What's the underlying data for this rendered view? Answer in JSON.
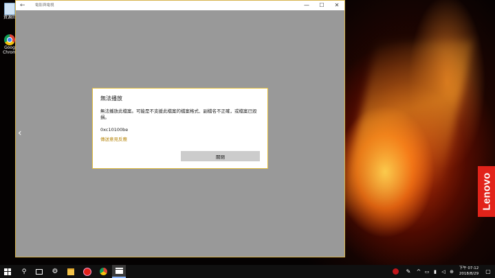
{
  "desktop": {
    "icons": [
      {
        "label": "資源回"
      },
      {
        "label": "Goog Chrom"
      }
    ],
    "brand": "Lenovo"
  },
  "window": {
    "title": "電影與電視",
    "back_glyph": "←",
    "min_glyph": "—",
    "max_glyph": "☐",
    "close_glyph": "✕",
    "prev_glyph": "‹"
  },
  "dialog": {
    "title": "無法播放",
    "message": "無法播放此檔案。可能是不支援此檔案的檔案格式、副檔名不正確，或檔案已毀損。",
    "error_code": "0xc10100be",
    "feedback_link": "傳送意見反應",
    "close_button": "關閉"
  },
  "taskbar": {
    "search_glyph": "⚲",
    "settings_glyph": "⚙",
    "tray": {
      "pen_glyph": "✎",
      "up_glyph": "^",
      "net_glyph": "▭",
      "battery_glyph": "▮",
      "volume_glyph": "◁",
      "ime_glyph": "⊕",
      "notification_glyph": "▢"
    },
    "clock": {
      "time": "下午 07:12",
      "date": "2018/8/29"
    }
  },
  "colors": {
    "dialog_border": "#e2bd3e",
    "link": "#b7860b",
    "lenovo_red": "#e2231a"
  }
}
